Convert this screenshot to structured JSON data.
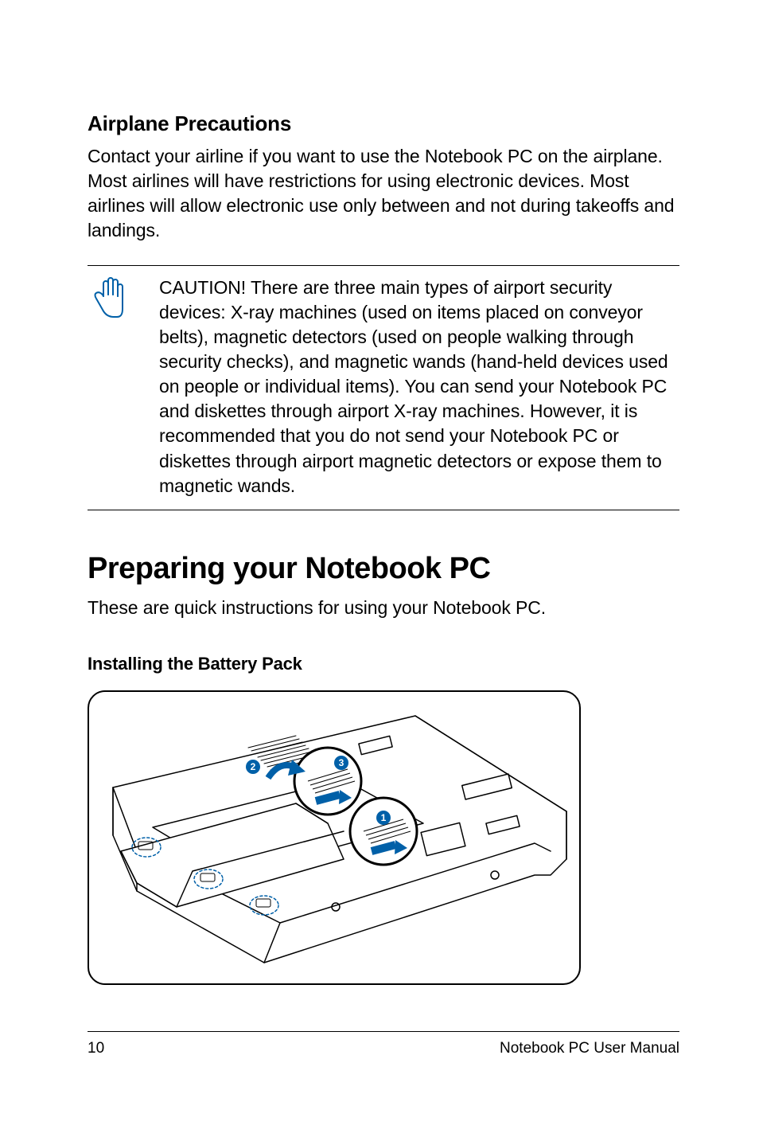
{
  "headings": {
    "airplane": "Airplane Precautions",
    "preparing": "Preparing your Notebook PC",
    "installing_battery": "Installing the Battery Pack"
  },
  "paragraphs": {
    "airplane_body": "Contact your airline if you want to use the Notebook PC on the airplane. Most airlines will have restrictions for using electronic devices. Most airlines will allow electronic use only between and not during takeoffs and landings.",
    "caution_body": "CAUTION! There are three main types of airport security devices: X-ray machines (used on items placed on conveyor belts), magnetic detectors (used on people walking through security checks), and magnetic wands (hand-held devices used on people or individual items). You can send your Notebook PC and diskettes through airport X-ray machines. However, it is recommended that you do not send your Notebook PC or diskettes through airport magnetic detectors or expose them to magnetic wands.",
    "preparing_intro": "These are quick instructions for using your Notebook PC."
  },
  "illustration": {
    "callouts": [
      "1",
      "2",
      "3"
    ]
  },
  "footer": {
    "page_number": "10",
    "doc_title": "Notebook PC User Manual"
  }
}
